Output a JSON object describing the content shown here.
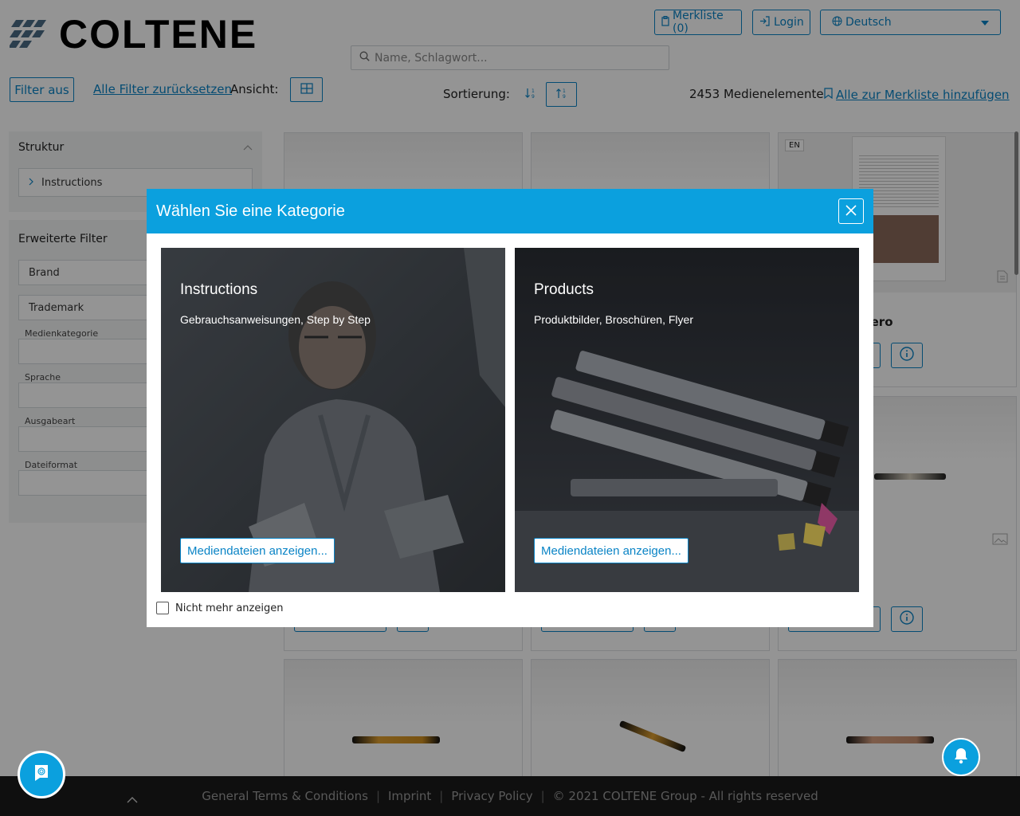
{
  "header": {
    "logo_text": "COLTENE",
    "merkliste_label": "Merkliste (0)",
    "login_label": "Login",
    "language_label": "Deutsch",
    "search_placeholder": "Name, Schlagwort..."
  },
  "toolbar": {
    "filter_off_label": "Filter aus",
    "reset_filters_label": "Alle Filter zurücksetzen",
    "view_label": "Ansicht:",
    "sort_label": "Sortierung:",
    "count_text": "2453 Medienelemente",
    "add_all_label": "Alle zur Merkliste hinzufügen"
  },
  "sidebar": {
    "structure_title": "Struktur",
    "structure_item": "Instructions",
    "advanced_title": "Erweiterte Filter",
    "brand_label": "Brand",
    "trademark_label": "Trademark",
    "fields": [
      {
        "label": "Medienkategorie"
      },
      {
        "label": "Sprache"
      },
      {
        "label": "Ausgabeart"
      },
      {
        "label": "Dateiformat"
      }
    ]
  },
  "cards": {
    "lang_badge": "EN",
    "partial_title": "mero"
  },
  "modal": {
    "title": "Wählen Sie eine Kategorie",
    "tiles": [
      {
        "title": "Instructions",
        "subtitle": "Gebrauchsanweisungen, Step by Step",
        "button": "Mediendateien anzeigen..."
      },
      {
        "title": "Products",
        "subtitle": "Produktbilder, Broschüren, Flyer",
        "button": "Mediendateien anzeigen..."
      }
    ],
    "dont_show_label": "Nicht mehr anzeigen"
  },
  "footer": {
    "terms": "General Terms & Conditions",
    "imprint": "Imprint",
    "privacy": "Privacy Policy",
    "copyright": "© 2021 COLTENE Group - All rights reserved"
  },
  "colors": {
    "accent": "#0ba0de",
    "link": "#0a84c6",
    "footer_bg": "#1a1a1a"
  }
}
